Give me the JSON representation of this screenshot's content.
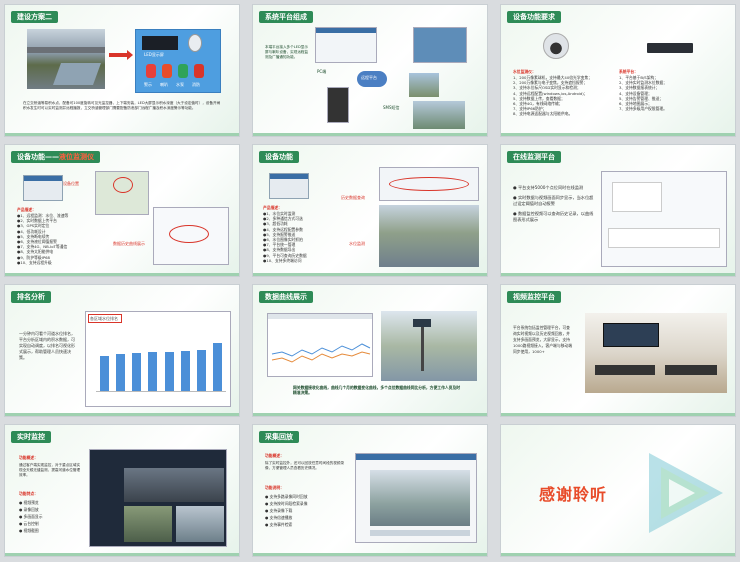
{
  "slides": [
    {
      "title": "建设方案二",
      "leds_label": "LED显示屏",
      "icons": [
        "警示",
        "喇叭",
        "水泵",
        "消防"
      ],
      "body": "在立交桥涵等易积水点，配备可100度旋转可见光监控器，上下端安装，LED大屏显示积水深度（大于设定值时），设备开闸积水发生时可以实时监测并远程播报，立交桥涵管理部门需要配备防泄部门远程广播及积水深度警示等功能。"
    },
    {
      "title": "系统平台组成",
      "body": "本端平台接入多个LED显示屏与喇叭设备，实现远程监测及广播通知功能。",
      "labels": [
        "远程平台",
        "SMS短信",
        "PC端"
      ]
    },
    {
      "title": "设备功能要求",
      "left_title": "水位监测仪：",
      "left_items": [
        "1、200万像素球机，支持最大40倍光学变焦；",
        "2、200万像素与电子变焦，支持遮挡报警；",
        "3、支持水位标尺OSD实时显示和检测；",
        "4、支持远程配置(windows,ios,Android)；",
        "5、支持数据上传，查看数据；",
        "6、支持4G，有线网络传输；",
        "7、支持IP66防护；",
        "8、支持电源适配器与太阳能供电。"
      ],
      "right_title": "系统平台：",
      "right_items": [
        "1、平台基于B/S架构；",
        "2、支持实时监测水位数据；",
        "3、支持数据报表统计；",
        "4、支持设备管理；",
        "5、支持告警管理、推送；",
        "6、支持地图展示；",
        "7、支持多级用户权限管理。"
      ]
    },
    {
      "title": "设备功能——",
      "title_accent": "液位监测仪",
      "annot_top": "设备位置",
      "annot_bottom": "数据历史曲线展示",
      "section": "产品描述：",
      "items": [
        "●1、远程监测：水位、流速等",
        "●2、实时数据上传平台",
        "●3、GPS实时定位",
        "●4、低功耗设计",
        "●5、支持断电续传",
        "●6、支持液位阈值报警",
        "●7、支持4G、NB-IoT等通信",
        "●8、支持太阳能供电",
        "●9、防护等级IP68",
        "●10、支持远程升级"
      ]
    },
    {
      "title": "设备功能",
      "annot_top": "历史数据查询",
      "annot_left": "水位监测",
      "section": "产品描述：",
      "items": [
        "●1、水位实时监测",
        "●2、多种通信方式可选",
        "●3、超低功耗",
        "●4、支持远程配置参数",
        "●5、支持报警推送",
        "●6、水位图像实时抓拍",
        "●7、平台统一管理",
        "●8、支持数据导出",
        "●9、平台可查询历史数据",
        "●10、支持多终端访问"
      ]
    },
    {
      "title": "在线监测平台",
      "items": [
        "● 平台支持5000个点位同时在线监测",
        "● 实时数据与视频画面同步显示，当水位超过设定阈值时自动报警",
        "● 数据监控视频可以查询历史记录，以曲线图表形式展示"
      ]
    },
    {
      "title": "排名分析",
      "body": "一分钟内可看个河道水位排名，平台分析区域内的积水数据，可实现自动调度，以排名可视化形式展示，帮助管理人员快速决策。",
      "chart_title": "各区域水位排名"
    },
    {
      "title": "数据曲线展示",
      "caption": "网关数据接收化曲线，曲线几个月的数据变化曲线，多个点位数据曲线同比分析，方便工作人员及时精准决策。"
    },
    {
      "title": "视频监控平台",
      "body": "平台系统包括监控管理平台，可查询实时视频以及历史视频回放，并支持多画面预览，大屏显示，支持1000路视频接入，客户端与移动端同步使用，1000+"
    },
    {
      "title": "实时监控",
      "heading": "功能概述：",
      "body": "通过客户端实现监控，对于重点区域实现全天候无缝监测，提高河道水位管理效率。",
      "feature_heading": "功能特点：",
      "features": [
        "● 视频预览",
        "● 录像回放",
        "● 多画面显示",
        "● 云台控制",
        "● 视频截图"
      ]
    },
    {
      "title": "采集回放",
      "heading": "功能概述：",
      "body": "除了实时监控外，还可以回放任意时间段的视频录像，方便管理人员查看历史情况。",
      "feature_heading": "功能说明：",
      "features": [
        "● 支持多路录像同时回放",
        "● 支持按时间段检索录像",
        "● 支持录像下载",
        "● 支持倍速播放",
        "● 支持事件检索"
      ]
    },
    {
      "title": "",
      "thanks": "感谢聆听"
    }
  ],
  "colors": {
    "accent": "#2e8b57",
    "highlight": "#d9352a",
    "bar": "#4b8fd8"
  },
  "chart_data": {
    "type": "bar",
    "categories": [
      "",
      "",
      "",
      "",
      "",
      "",
      "",
      ""
    ],
    "values": [
      34,
      36,
      37,
      38,
      38,
      39,
      40,
      46
    ],
    "title": "",
    "xlabel": "",
    "ylabel": "",
    "ylim": [
      0,
      60
    ]
  }
}
